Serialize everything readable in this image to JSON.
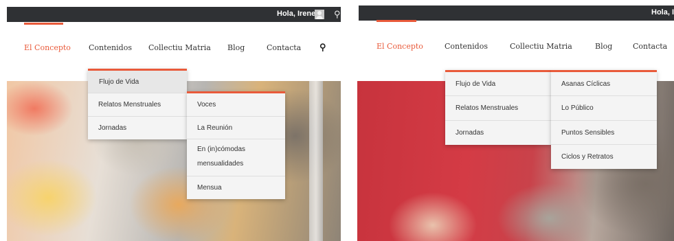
{
  "left": {
    "topbar": {
      "greeting": "Hola, Irene"
    },
    "nav": {
      "items": [
        "El Concepto",
        "Contenidos",
        "Collectiu Matria",
        "Blog",
        "Contacta"
      ],
      "active": "El Concepto"
    },
    "submenu": {
      "items": [
        "Flujo de Vida",
        "Relatos Menstruales",
        "Jornadas"
      ]
    },
    "subsubmenu": {
      "items": [
        "Voces",
        "La Reunión",
        "En (in)cómodas mensualidades",
        "Mensua"
      ]
    }
  },
  "right": {
    "topbar": {
      "greeting": "Hola, Ir"
    },
    "nav": {
      "items": [
        "El Concepto",
        "Contenidos",
        "Collectiu Matria",
        "Blog",
        "Contacta"
      ],
      "active": "El Concepto"
    },
    "submenu": {
      "items": [
        "Flujo de Vida",
        "Relatos Menstruales",
        "Jornadas"
      ]
    },
    "subsubmenu": {
      "items": [
        "Asanas Cíclicas",
        "Lo Público",
        "Puntos Sensibles",
        "Ciclos y Retratos"
      ]
    }
  },
  "colors": {
    "accent": "#e95a3a",
    "topbar": "#2f3134"
  },
  "icons": {
    "search": "search-icon",
    "avatar": "user-avatar-icon"
  }
}
